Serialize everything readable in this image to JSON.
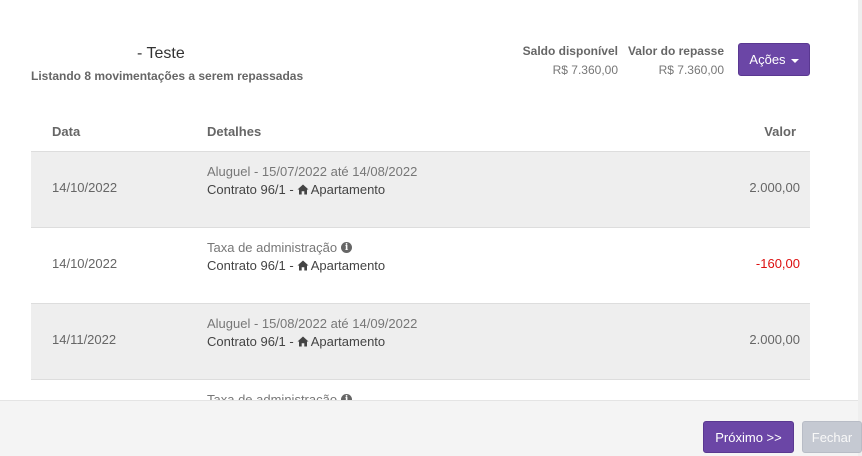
{
  "header": {
    "title": "- Teste",
    "subtitle": "Listando 8 movimentações a serem repassadas"
  },
  "stats": {
    "saldo_label": "Saldo disponível",
    "saldo_value": "R$ 7.360,00",
    "repasse_label": "Valor do repasse",
    "repasse_value": "R$ 7.360,00"
  },
  "actions": {
    "label": "Ações"
  },
  "table": {
    "headers": {
      "date": "Data",
      "details": "Detalhes",
      "value": "Valor"
    },
    "rows": [
      {
        "date": "14/10/2022",
        "line1": "Aluguel - 15/07/2022 até 14/08/2022",
        "contract": "Contrato 96/1 -",
        "property": "Apartamento",
        "value": "2.000,00",
        "has_info": false
      },
      {
        "date": "14/10/2022",
        "line1": "Taxa de administração",
        "contract": "Contrato 96/1 -",
        "property": "Apartamento",
        "value": "-160,00",
        "has_info": true
      },
      {
        "date": "14/11/2022",
        "line1": "Aluguel - 15/08/2022 até 14/09/2022",
        "contract": "Contrato 96/1 -",
        "property": "Apartamento",
        "value": "2.000,00",
        "has_info": false
      },
      {
        "date": "",
        "line1": "Taxa de administração",
        "contract": "",
        "property": "",
        "value": "",
        "has_info": true
      }
    ]
  },
  "footer": {
    "next_label": "Próximo >>",
    "close_label": "Fechar"
  },
  "colors": {
    "primary": "#6b46a6",
    "negative": "#dd1111",
    "row_alt": "#eeeeee",
    "disabled": "#c5c9d2"
  },
  "icons": {
    "home": "home-icon",
    "info": "info-icon",
    "caret": "caret-down-icon"
  }
}
